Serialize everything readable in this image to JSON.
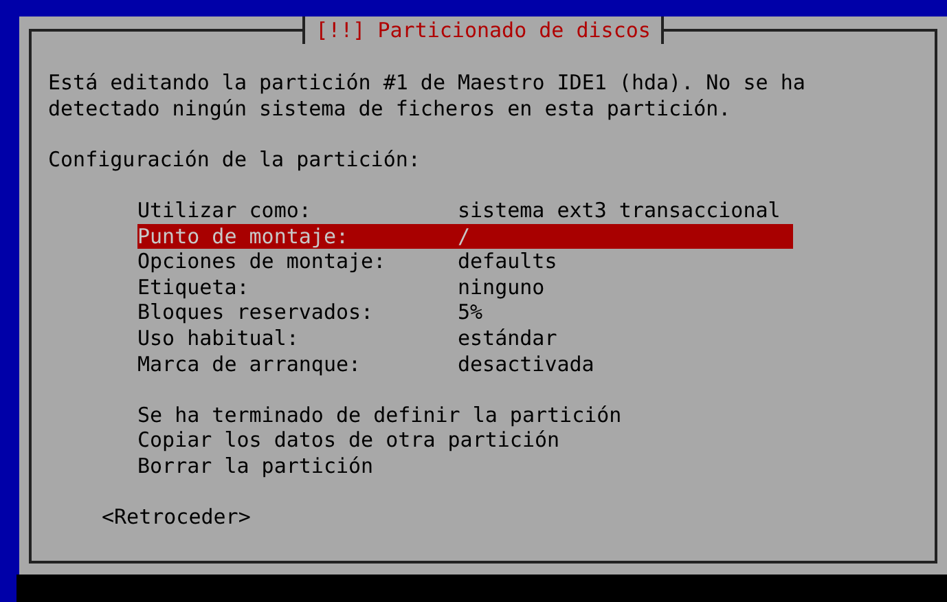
{
  "dialog": {
    "title": "[!!] Particionado de discos",
    "description": "Está editando la partición #1 de Maestro IDE1 (hda). No se ha detectado ningún sistema de ficheros en esta partición.",
    "section_label": "Configuración de la partición:",
    "options": [
      {
        "label": "Utilizar como:",
        "value": "sistema ext3 transaccional",
        "selected": false
      },
      {
        "label": "Punto de montaje:",
        "value": "/",
        "selected": true
      },
      {
        "label": "Opciones de montaje:",
        "value": "defaults",
        "selected": false
      },
      {
        "label": "Etiqueta:",
        "value": "ninguno",
        "selected": false
      },
      {
        "label": "Bloques reservados:",
        "value": "5%",
        "selected": false
      },
      {
        "label": "Uso habitual:",
        "value": "estándar",
        "selected": false
      },
      {
        "label": "Marca de arranque:",
        "value": "desactivada",
        "selected": false
      }
    ],
    "actions": [
      {
        "label": "Se ha terminado de definir la partición",
        "selected": false
      },
      {
        "label": "Copiar los datos de otra partición",
        "selected": false
      },
      {
        "label": "Borrar la partición",
        "selected": false
      }
    ],
    "back_button": "<Retroceder>"
  }
}
